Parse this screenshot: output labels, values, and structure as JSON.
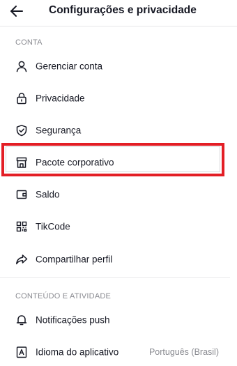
{
  "header": {
    "title": "Configurações e privacidade",
    "back_icon": "arrow-left-icon"
  },
  "sections": [
    {
      "title": "CONTA",
      "items": [
        {
          "label": "Gerenciar conta",
          "icon": "user-icon"
        },
        {
          "label": "Privacidade",
          "icon": "lock-icon"
        },
        {
          "label": "Segurança",
          "icon": "shield-icon"
        },
        {
          "label": "Pacote corporativo",
          "icon": "store-icon"
        },
        {
          "label": "Saldo",
          "icon": "wallet-icon"
        },
        {
          "label": "TikCode",
          "icon": "qr-code-icon"
        },
        {
          "label": "Compartilhar perfil",
          "icon": "share-icon"
        }
      ]
    },
    {
      "title": "CONTEÚDO E ATIVIDADE",
      "items": [
        {
          "label": "Notificações push",
          "icon": "bell-icon"
        },
        {
          "label": "Idioma do aplicativo",
          "icon": "language-icon",
          "value": "Português (Brasil)"
        }
      ]
    }
  ],
  "colors": {
    "highlight": "#e31e25",
    "text": "#161823",
    "secondary_text": "#8a8b91"
  }
}
